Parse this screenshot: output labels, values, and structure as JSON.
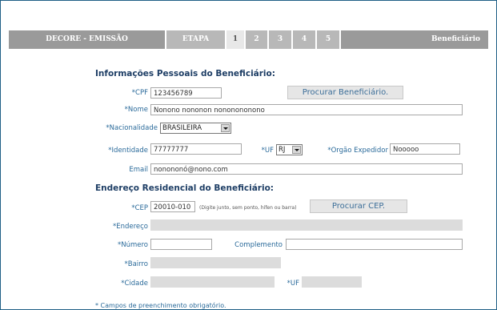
{
  "stepbar": {
    "title": "DECORE - EMISSÃO",
    "etapa_label": "ETAPA",
    "steps": [
      "1",
      "2",
      "3",
      "4",
      "5"
    ],
    "section": "Beneficiário"
  },
  "personal": {
    "heading": "Informações Pessoais do Beneficiário:",
    "cpf_label": "*CPF",
    "cpf_value": "123456789",
    "search_button": "Procurar Beneficiário.",
    "nome_label": "*Nome",
    "nome_value": "Nonono nononon nononononono",
    "nacionalidade_label": "*Nacionalidade",
    "nacionalidade_value": "BRASILEIRA",
    "identidade_label": "*Identidade",
    "identidade_value": "77777777",
    "uf_label": "*UF",
    "uf_value": "RJ",
    "orgao_label": "*Orgão Expedidor",
    "orgao_value": "Nooooo",
    "email_label": "Email",
    "email_value": "nonononó@nono.com"
  },
  "address": {
    "heading": "Endereço Residencial do Beneficiário:",
    "cep_label": "*CEP",
    "cep_value": "20010-010",
    "cep_hint": "(Digite junto, sem ponto, hífen ou barra)",
    "cep_button": "Procurar CEP.",
    "endereco_label": "*Endereço",
    "numero_label": "*Número",
    "complemento_label": "Complemento",
    "bairro_label": "*Bairro",
    "cidade_label": "*Cidade",
    "uf_label": "*UF"
  },
  "footnote": "* Campos de preenchimento obrigatório."
}
